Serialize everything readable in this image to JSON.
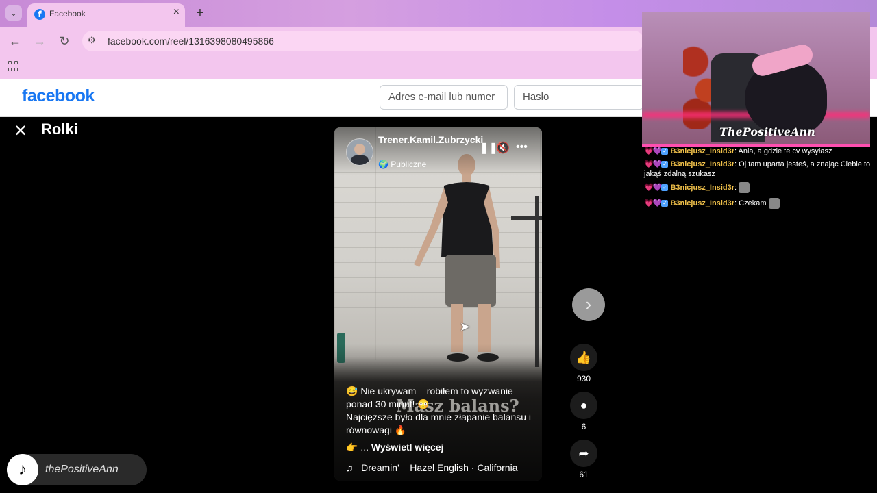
{
  "browser": {
    "tab_title": "Facebook",
    "url": "facebook.com/reel/1316398080495866"
  },
  "facebook": {
    "logo": "facebook",
    "email_placeholder": "Adres e-mail lub numer",
    "password_placeholder": "Hasło"
  },
  "reels": {
    "title": "Rolki",
    "author": "Trener.Kamil.Zubrzycki",
    "visibility": "Publiczne",
    "overlay_text": "Masz balans?",
    "caption_line1": "😅 Nie ukrywam – robiłem to wyzwanie ponad 30 minut! 😳",
    "caption_line2": "Najcięższe było dla mnie złapanie balansu i równowagi 🔥",
    "more_prefix": "👉 ...",
    "more_label": "Wyświetl więcej",
    "music": "Dreamin'    Hazel English · California",
    "likes": "930",
    "comments": "6",
    "shares": "61"
  },
  "stream": {
    "cam_name": "ThePositiveAnn",
    "chat": [
      {
        "user": "B3nicjusz_Insid3r",
        "text": "Ania, a gdzie te cv wysyłasz"
      },
      {
        "user": "B3nicjusz_Insid3r",
        "text": "Oj tam uparta jesteś, a znając Ciebie to jakąś zdalną szukasz"
      },
      {
        "user": "B3nicjusz_Insid3r",
        "text": ""
      },
      {
        "user": "B3nicjusz_Insid3r",
        "text": "Czekam"
      }
    ],
    "tiktok_handle": "thePositiveAnn"
  },
  "icons": [
    "facebook-favicon-icon",
    "close-icon",
    "plus-icon",
    "back-icon",
    "forward-icon",
    "reload-icon",
    "site-settings-icon",
    "apps-icon",
    "pause-icon",
    "mute-icon",
    "more-icon",
    "chevron-right-icon",
    "like-icon",
    "comment-icon",
    "share-icon",
    "tiktok-icon",
    "globe-icon",
    "music-icon"
  ]
}
